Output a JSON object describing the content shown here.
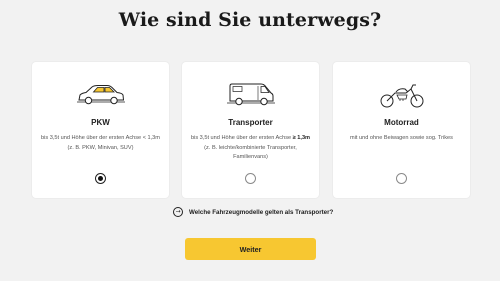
{
  "page": {
    "title": "Wie sind Sie unterwegs?"
  },
  "options": [
    {
      "title": "PKW",
      "desc_plain": "bis 3,5t und Höhe über der ersten Achse < 1,3m (z. B. PKW, Minivan, SUV)",
      "selected": true,
      "icon": "car-icon"
    },
    {
      "title": "Transporter",
      "desc_prefix": "bis 3,5t und Höhe über der ersten Achse ",
      "desc_bold": "≥ 1,3m",
      "desc_suffix": " (z. B. leichte/kombinierte Transporter, Familienvans)",
      "selected": false,
      "icon": "van-icon"
    },
    {
      "title": "Motorrad",
      "desc_plain": "mit und ohne Beiwagen sowie sog. Trikes",
      "selected": false,
      "icon": "motorcycle-icon"
    }
  ],
  "info_link": {
    "label": "Welche Fahrzeugmodelle gelten als Transporter?",
    "icon": "arrow-right-circle-icon"
  },
  "actions": {
    "continue_label": "Weiter"
  },
  "colors": {
    "accent": "#f7c731",
    "background": "#f2f2f2",
    "card": "#ffffff",
    "text": "#1e1e1e"
  }
}
